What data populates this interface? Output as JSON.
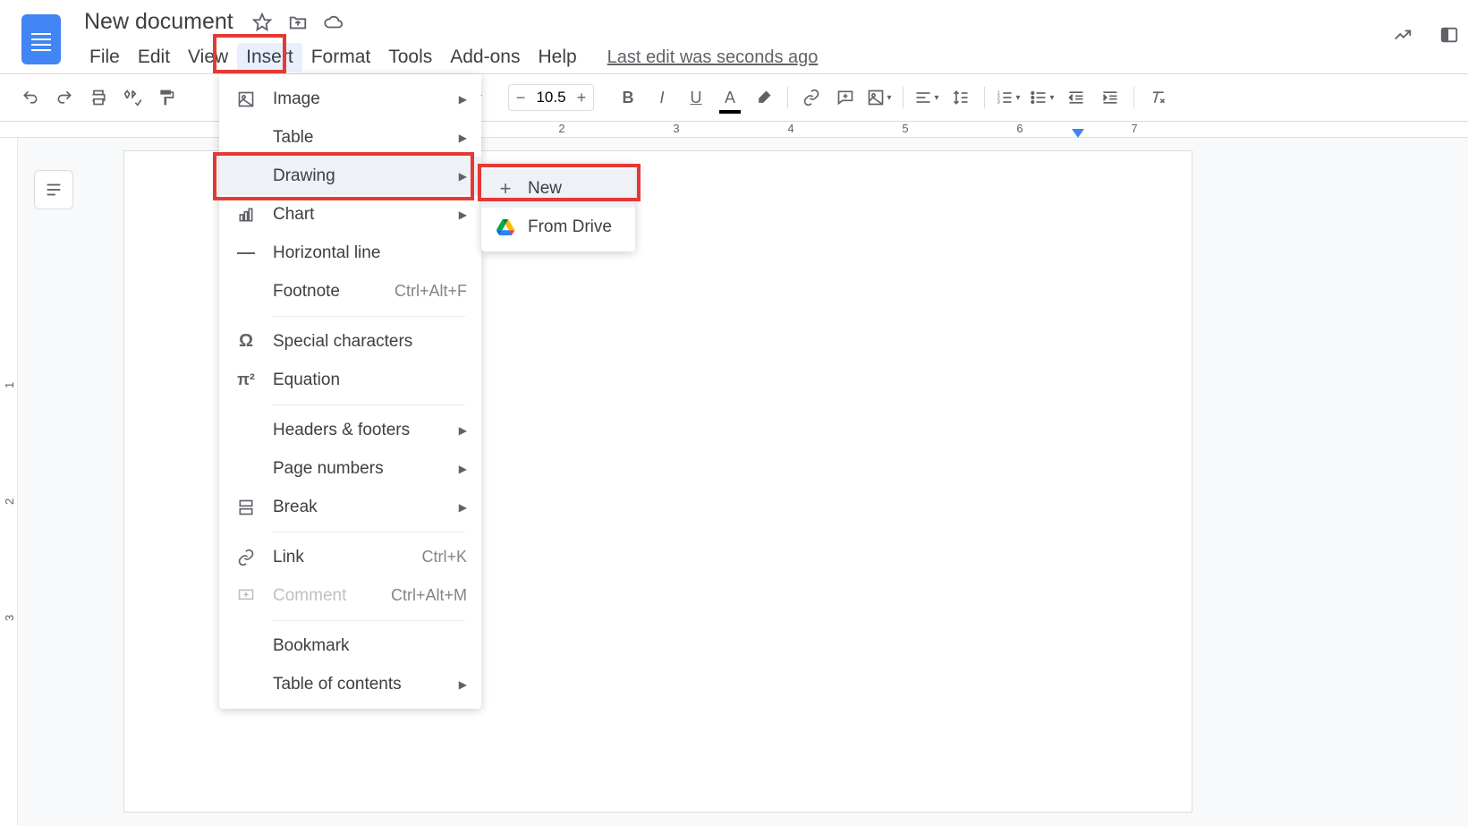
{
  "doc": {
    "title": "New document",
    "last_edit": "Last edit was seconds ago"
  },
  "menubar": {
    "file": "File",
    "edit": "Edit",
    "view": "View",
    "insert": "Insert",
    "format": "Format",
    "tools": "Tools",
    "addons": "Add-ons",
    "help": "Help"
  },
  "toolbar": {
    "font_size": "10.5"
  },
  "ruler": {
    "ticks": [
      "2",
      "3",
      "4",
      "5",
      "6",
      "7"
    ]
  },
  "insert_menu": {
    "image": "Image",
    "table": "Table",
    "drawing": "Drawing",
    "chart": "Chart",
    "hline": "Horizontal line",
    "footnote": {
      "label": "Footnote",
      "shortcut": "Ctrl+Alt+F"
    },
    "special": "Special characters",
    "equation": "Equation",
    "headers": "Headers & footers",
    "pagenums": "Page numbers",
    "break": "Break",
    "link": {
      "label": "Link",
      "shortcut": "Ctrl+K"
    },
    "comment": {
      "label": "Comment",
      "shortcut": "Ctrl+Alt+M"
    },
    "bookmark": "Bookmark",
    "toc": "Table of contents"
  },
  "drawing_submenu": {
    "new": "New",
    "from_drive": "From Drive"
  },
  "vruler": {
    "ticks": [
      "1",
      "2",
      "3"
    ]
  }
}
